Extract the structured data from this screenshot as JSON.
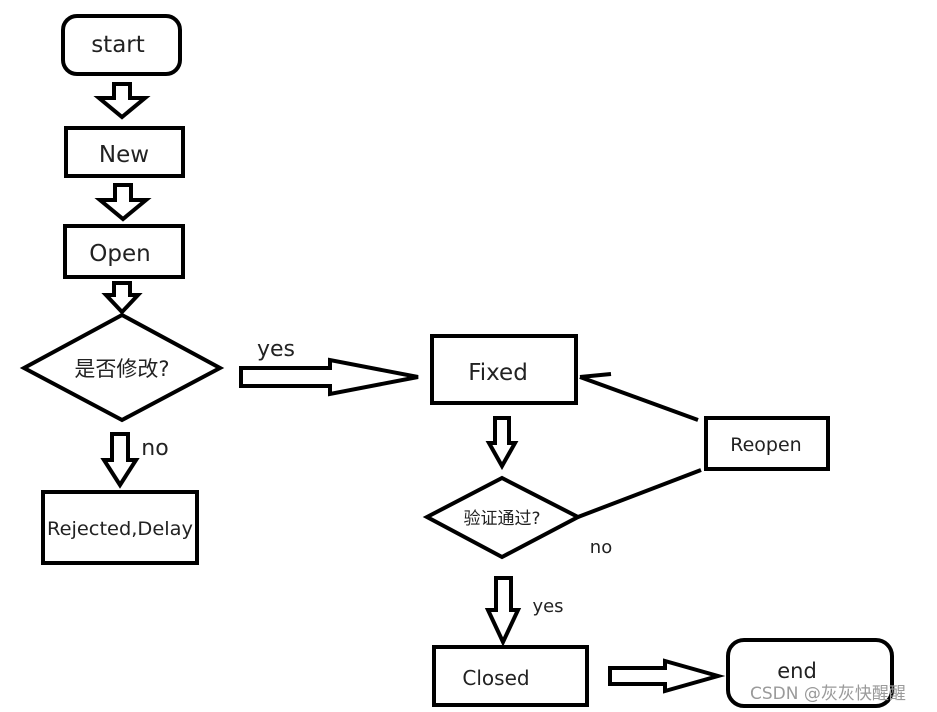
{
  "nodes": {
    "start": "start",
    "new": "New",
    "open": "Open",
    "decision_modify": "是否修改?",
    "rejected": "Rejected,Delay",
    "fixed": "Fixed",
    "decision_verify": "验证通过?",
    "reopen": "Reopen",
    "closed": "Closed",
    "end": "end"
  },
  "edges": {
    "modify_yes": "yes",
    "modify_no": "no",
    "verify_no": "no",
    "verify_yes": "yes"
  },
  "watermark": "CSDN @灰灰快醒醒"
}
